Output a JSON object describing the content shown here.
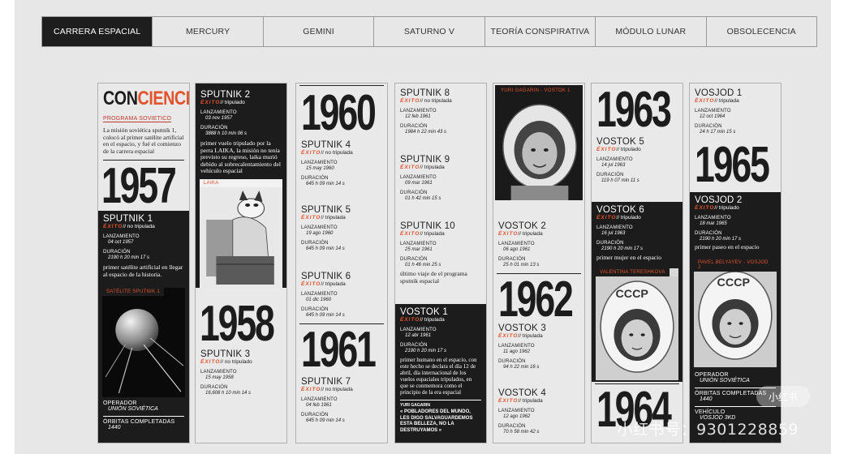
{
  "nav": {
    "items": [
      "CARRERA ESPACIAL",
      "MERCURY",
      "GEMINI",
      "SATURNO V",
      "TEORÍA CONSPIRATIVA",
      "MÓDULO LUNAR",
      "OBSOLECENCIA"
    ]
  },
  "col1": {
    "logo_a": "CON",
    "logo_b": "CIENCIA",
    "subtitle": "PROGRAMA SOVIETICO",
    "intro": "La misión soviética sputnik 1, colocó al primer satélite artificial en el espacio, y fué el comienzo de la carrera espacial",
    "year": "1957",
    "sputnik1": {
      "name": "SPUTNIK 1",
      "status_a": "ÉXITO",
      "status_b": "// no tripulada",
      "lanz_label": "LANZAMIENTO",
      "lanz": "04 oct 1957",
      "dur_label": "DURACIÓN",
      "dur": "2190 h 20 min 17 s",
      "note": "primer satélite artificial en llegar al espacio de la historia."
    },
    "photo_caption": "SATÉLITE SPUTNIK 1",
    "operador_label": "OPERADOR",
    "operador": "UNIÓN SOVIÉTICA",
    "orbitas_label": "ÓRBITAS COMPLETADAS",
    "orbitas": "1440"
  },
  "col2": {
    "sputnik2": {
      "name": "SPUTNIK 2",
      "status_a": "ÉXITO",
      "status_b": "// tripulado",
      "lanz_label": "LANZAMIENTO",
      "lanz": "03 nov 1957",
      "dur_label": "DURACIÓN",
      "dur": "3888 h 10 min 06 s",
      "note": "primer vuelo tripulado por la perra LAIKA, la misión no tenia previsto su regreso, laika murió debido al sobrecalentamiento del vehículo espacial"
    },
    "photo_caption": "LAIKA",
    "year": "1958",
    "sputnik3": {
      "name": "SPUTNIK 3",
      "status_a": "ÉXITO",
      "status_b": "// no tripulado",
      "lanz_label": "LANZAMIENTO",
      "lanz": "15 may 1958",
      "dur_label": "DURACIÓN",
      "dur": "16,608 h 10 min 14 s"
    }
  },
  "col3": {
    "year_a": "1960",
    "sputnik4": {
      "name": "SPUTNIK 4",
      "status_a": "ÉXITO",
      "status_b": "// no tripulada",
      "lanz_label": "LANZAMIENTO",
      "lanz": "15 may 1960",
      "dur_label": "DURACIÓN",
      "dur": "645 h 09 min 14 s"
    },
    "sputnik5": {
      "name": "SPUTNIK 5",
      "status_a": "ÉXITO",
      "status_b": "// tripulada",
      "lanz_label": "LANZAMIENTO",
      "lanz": "19 ago 1960",
      "dur_label": "DURACIÓN",
      "dur": "645 h 09 min 14 s"
    },
    "sputnik6": {
      "name": "SPUTNIK 6",
      "status_a": "ÉXITO",
      "status_b": "// tripulada",
      "lanz_label": "LANZAMIENTO",
      "lanz": "01 dic 1960",
      "dur_label": "DURACIÓN",
      "dur": "645 h 09 min 14 s"
    },
    "year_b": "1961",
    "sputnik7": {
      "name": "SPUTNIK 7",
      "status_a": "ÉXITO",
      "status_b": "// no tripulada",
      "lanz_label": "LANZAMIENTO",
      "lanz": "04 feb 1961",
      "dur_label": "DURACIÓN",
      "dur": "645 h 09 min 14 s"
    }
  },
  "col4": {
    "sputnik8": {
      "name": "SPUTNIK 8",
      "status_a": "ÉXITO",
      "status_b": "// no tripulada",
      "lanz_label": "LANZAMIENTO",
      "lanz": "12 feb 1961",
      "dur_label": "DURACIÓN",
      "dur": "1984 h 22 min 43 s"
    },
    "sputnik9": {
      "name": "SPUTNIK 9",
      "status_a": "ÉXITO",
      "status_b": "// tripulada",
      "lanz_label": "LANZAMIENTO",
      "lanz": "09 mar 1961",
      "dur_label": "DURACIÓN",
      "dur": "01 h 42 min 15 s"
    },
    "sputnik10": {
      "name": "SPUTNIK 10",
      "status_a": "ÉXITO",
      "status_b": "// tripulada",
      "lanz_label": "LANZAMIENTO",
      "lanz": "25 mar 1961",
      "dur_label": "DURACIÓN",
      "dur": "01 h 46 min 25 s"
    },
    "note10": "último viaje de el programa sputnik espacial",
    "vostok1": {
      "name": "VOSTOK 1",
      "status_a": "ÉXITO",
      "status_b": "// tripulada",
      "lanz_label": "LANZAMIENTO",
      "lanz": "12 abr 1961",
      "dur_label": "DURACIÓN",
      "dur": "2190 h 20 min 17 s",
      "note": "primer humano en el espacio, con este hecho se declara el día 12 de abril, día internacional de los vuelos espaciales tripulados, en que se conmemora como el principio de la era espacial"
    },
    "quote_author": "YURI GAGARIN",
    "quote": "« POBLADORES DEL MUNDO, LES DIGO SALVAGUARDEMOS ESTA BELLEZA, NO LA DESTRUYAMOS »"
  },
  "col5": {
    "photo_caption": "YURI GAGARIN - VOSTOK 1",
    "vostok2": {
      "name": "VOSTOK 2",
      "status_a": "ÉXITO",
      "status_b": "// tripulada",
      "lanz_label": "LANZAMIENTO",
      "lanz": "06 ago 1961",
      "dur_label": "DURACIÓN",
      "dur": "25 h 01 min 13 s"
    },
    "year": "1962",
    "vostok3": {
      "name": "VOSTOK 3",
      "status_a": "ÉXITO",
      "status_b": "// tripulada",
      "lanz_label": "LANZAMIENTO",
      "lanz": "11 ago 1962",
      "dur_label": "DURACIÓN",
      "dur": "94 h 22 min 16 s"
    },
    "vostok4": {
      "name": "VOSTOK 4",
      "status_a": "ÉXITO",
      "status_b": "// tripulada",
      "lanz_label": "LANZAMIENTO",
      "lanz": "12 ago 1962",
      "dur_label": "DURACIÓN",
      "dur": "70 h 58 min 42 s"
    }
  },
  "col6": {
    "year_a": "1963",
    "vostok5": {
      "name": "VOSTOK 5",
      "status_a": "ÉXITO",
      "status_b": "// tripulado",
      "lanz_label": "LANZAMIENTO",
      "lanz": "14 jul 1963",
      "dur_label": "DURACIÓN",
      "dur": "119 h 07 min 11 s"
    },
    "vostok6": {
      "name": "VOSTOK 6",
      "status_a": "ÉXITO",
      "status_b": "// tripulado",
      "lanz_label": "LANZAMIENTO",
      "lanz": "16 jul 1963",
      "dur_label": "DURACIÓN",
      "dur": "2190 h 20 min 17 s",
      "note": "primer mujer en el espacio"
    },
    "photo_caption": "VALENTINA TERESHKOVA",
    "year_b": "1964"
  },
  "col7": {
    "vosjod1": {
      "name": "VOSJOD 1",
      "status_a": "ÉXITO",
      "status_b": "// tripulada",
      "lanz_label": "LANZAMIENTO",
      "lanz": "12 oct 1964",
      "dur_label": "DURACIÓN",
      "dur": "24 h 17 min 15 s"
    },
    "year": "1965",
    "vosjod2": {
      "name": "VOSJOD 2",
      "status_a": "ÉXITO",
      "status_b": "// tripulado",
      "lanz_label": "LANZAMIENTO",
      "lanz": "18 mar 1965",
      "dur_label": "DURACIÓN",
      "dur": "2190 h 20 min 17 s",
      "note": "primer paseo en el espacio"
    },
    "photo_caption": "PAVEL BELYAYEV - VOSJOD 2",
    "operador_label": "OPERADOR",
    "operador": "UNIÓN SOVIÉTICA",
    "orbitas_label": "ÓRBITAS COMPLETADAS",
    "orbitas": "1440",
    "vehiculo_label": "VEHÍCULO",
    "vehiculo": "VOSJOD 3KD"
  },
  "helmet_text": "CCCP",
  "watermark": "小红书号：9301228859",
  "watermark_badge": "小红书",
  "colors": {
    "accent": "#e2532b",
    "dark": "#1c1c1c",
    "panel": "#e9e9e9"
  }
}
